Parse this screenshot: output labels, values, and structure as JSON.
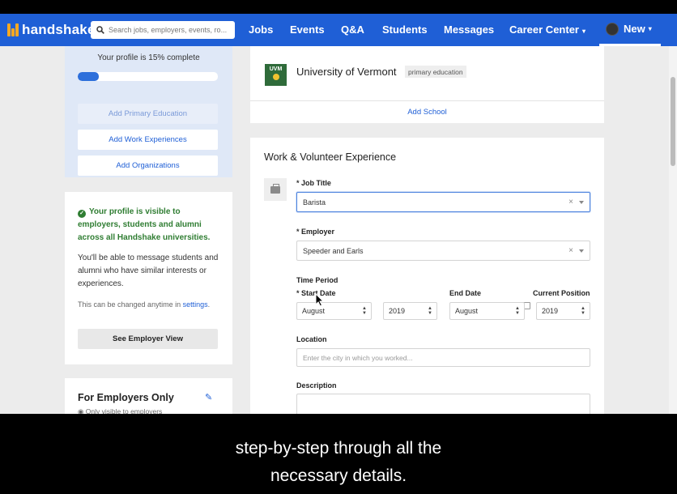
{
  "nav": {
    "logo": "handshake",
    "search_placeholder": "Search jobs, employers, events, ro...",
    "items": [
      {
        "label": "Jobs"
      },
      {
        "label": "Events"
      },
      {
        "label": "Q&A"
      },
      {
        "label": "Students"
      },
      {
        "label": "Messages"
      },
      {
        "label": "Career Center",
        "dropdown": true
      },
      {
        "label": "New",
        "dropdown": true,
        "active": true
      }
    ],
    "career_caret": "▾",
    "new_caret": "▾"
  },
  "profile_progress": {
    "title": "Your profile is 15% complete",
    "percent": 15,
    "buttons": [
      {
        "label": "Add Primary Education",
        "disabled": true
      },
      {
        "label": "Add Work Experiences"
      },
      {
        "label": "Add Organizations"
      }
    ]
  },
  "visibility": {
    "headline": "Your profile is visible to employers, students and alumni across all Handshake universities.",
    "body": "You'll be able to message students and alumni who have similar interests or experiences.",
    "note_prefix": "This can be changed anytime in",
    "note_link": "settings",
    "note_suffix": ".",
    "button": "See Employer View"
  },
  "employers_only": {
    "title": "For Employers Only",
    "subtitle": "Only visible to employers"
  },
  "education": {
    "logo_text": "UVM",
    "school": "University of Vermont",
    "badge": "primary education",
    "add_link": "Add School"
  },
  "work": {
    "section_title": "Work & Volunteer Experience",
    "job_title_label": "Job Title",
    "job_title_value": "Barista",
    "employer_label": "Employer",
    "employer_value": "Speeder and Earls",
    "required_mark": "*",
    "time_period_label": "Time Period",
    "start_date_label": "Start Date",
    "end_date_label": "End Date",
    "current_position_label": "Current Position",
    "current_position_checked": false,
    "start_month": "August",
    "start_year": "2019",
    "end_month": "August",
    "end_year": "2019",
    "location_label": "Location",
    "location_placeholder": "Enter the city in which you worked...",
    "description_label": "Description",
    "clear_glyph": "×",
    "spinner_glyph": "▲▼"
  },
  "caption": {
    "line1": "step-by-step through all the",
    "line2": "necessary details."
  },
  "colors": {
    "nav_bg": "#1f5fd6",
    "accent": "#1f5fd6",
    "success": "#2f7d32",
    "logo_accent": "#f7a823"
  }
}
